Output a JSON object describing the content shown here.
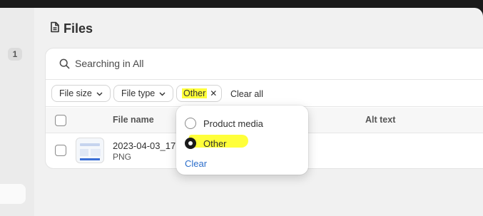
{
  "sidebar": {
    "badge": "1"
  },
  "page": {
    "title": "Files",
    "title_icon": "file-icon"
  },
  "search": {
    "text": "Searching in All",
    "icon": "search-icon"
  },
  "filters": {
    "file_size": "File size",
    "file_type": "File type",
    "other": "Other",
    "clear_all": "Clear all"
  },
  "table": {
    "headers": {
      "file_name": "File name",
      "alt_text": "Alt text"
    },
    "rows": [
      {
        "file_name": "2023-04-03_17",
        "file_type": "PNG"
      }
    ]
  },
  "popover": {
    "options": [
      {
        "label": "Product media",
        "checked": false
      },
      {
        "label": "Other",
        "checked": true
      }
    ],
    "clear": "Clear"
  },
  "colors": {
    "highlight": "#ffff3a",
    "link": "#2c6ecb",
    "topbar": "#1a1a1a"
  }
}
